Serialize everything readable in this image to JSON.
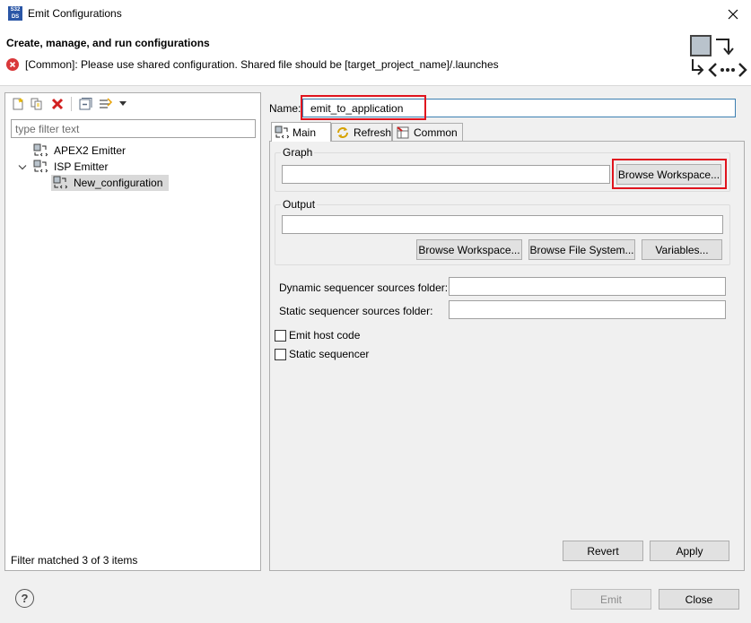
{
  "window": {
    "title": "Emit Configurations",
    "app_icon_text": "S32DS"
  },
  "header": {
    "title": "Create, manage, and run configurations",
    "error_message": "[Common]: Please use shared configuration. Shared file should be [target_project_name]/.launches"
  },
  "left": {
    "filter_placeholder": "type filter text",
    "tree": {
      "item1": "APEX2 Emitter",
      "item2": "ISP Emitter",
      "item3": "New_configuration"
    },
    "status": "Filter matched 3 of 3 items"
  },
  "right": {
    "name_label": "Name:",
    "name_value": "emit_to_application",
    "tabs": {
      "main": "Main",
      "refresh": "Refresh",
      "common": "Common"
    },
    "graph": {
      "label": "Graph",
      "value": "",
      "browse_label": "Browse Workspace..."
    },
    "output": {
      "label": "Output",
      "value": "",
      "browse_workspace": "Browse Workspace...",
      "browse_fs": "Browse File System...",
      "variables": "Variables..."
    },
    "dynamic_label": "Dynamic sequencer sources folder:",
    "dynamic_value": "",
    "static_label": "Static sequencer sources folder:",
    "static_value": "",
    "emit_host_code": "Emit host code",
    "static_sequencer": "Static sequencer",
    "revert": "Revert",
    "apply": "Apply"
  },
  "footer": {
    "emit": "Emit",
    "close": "Close",
    "help_glyph": "?"
  }
}
